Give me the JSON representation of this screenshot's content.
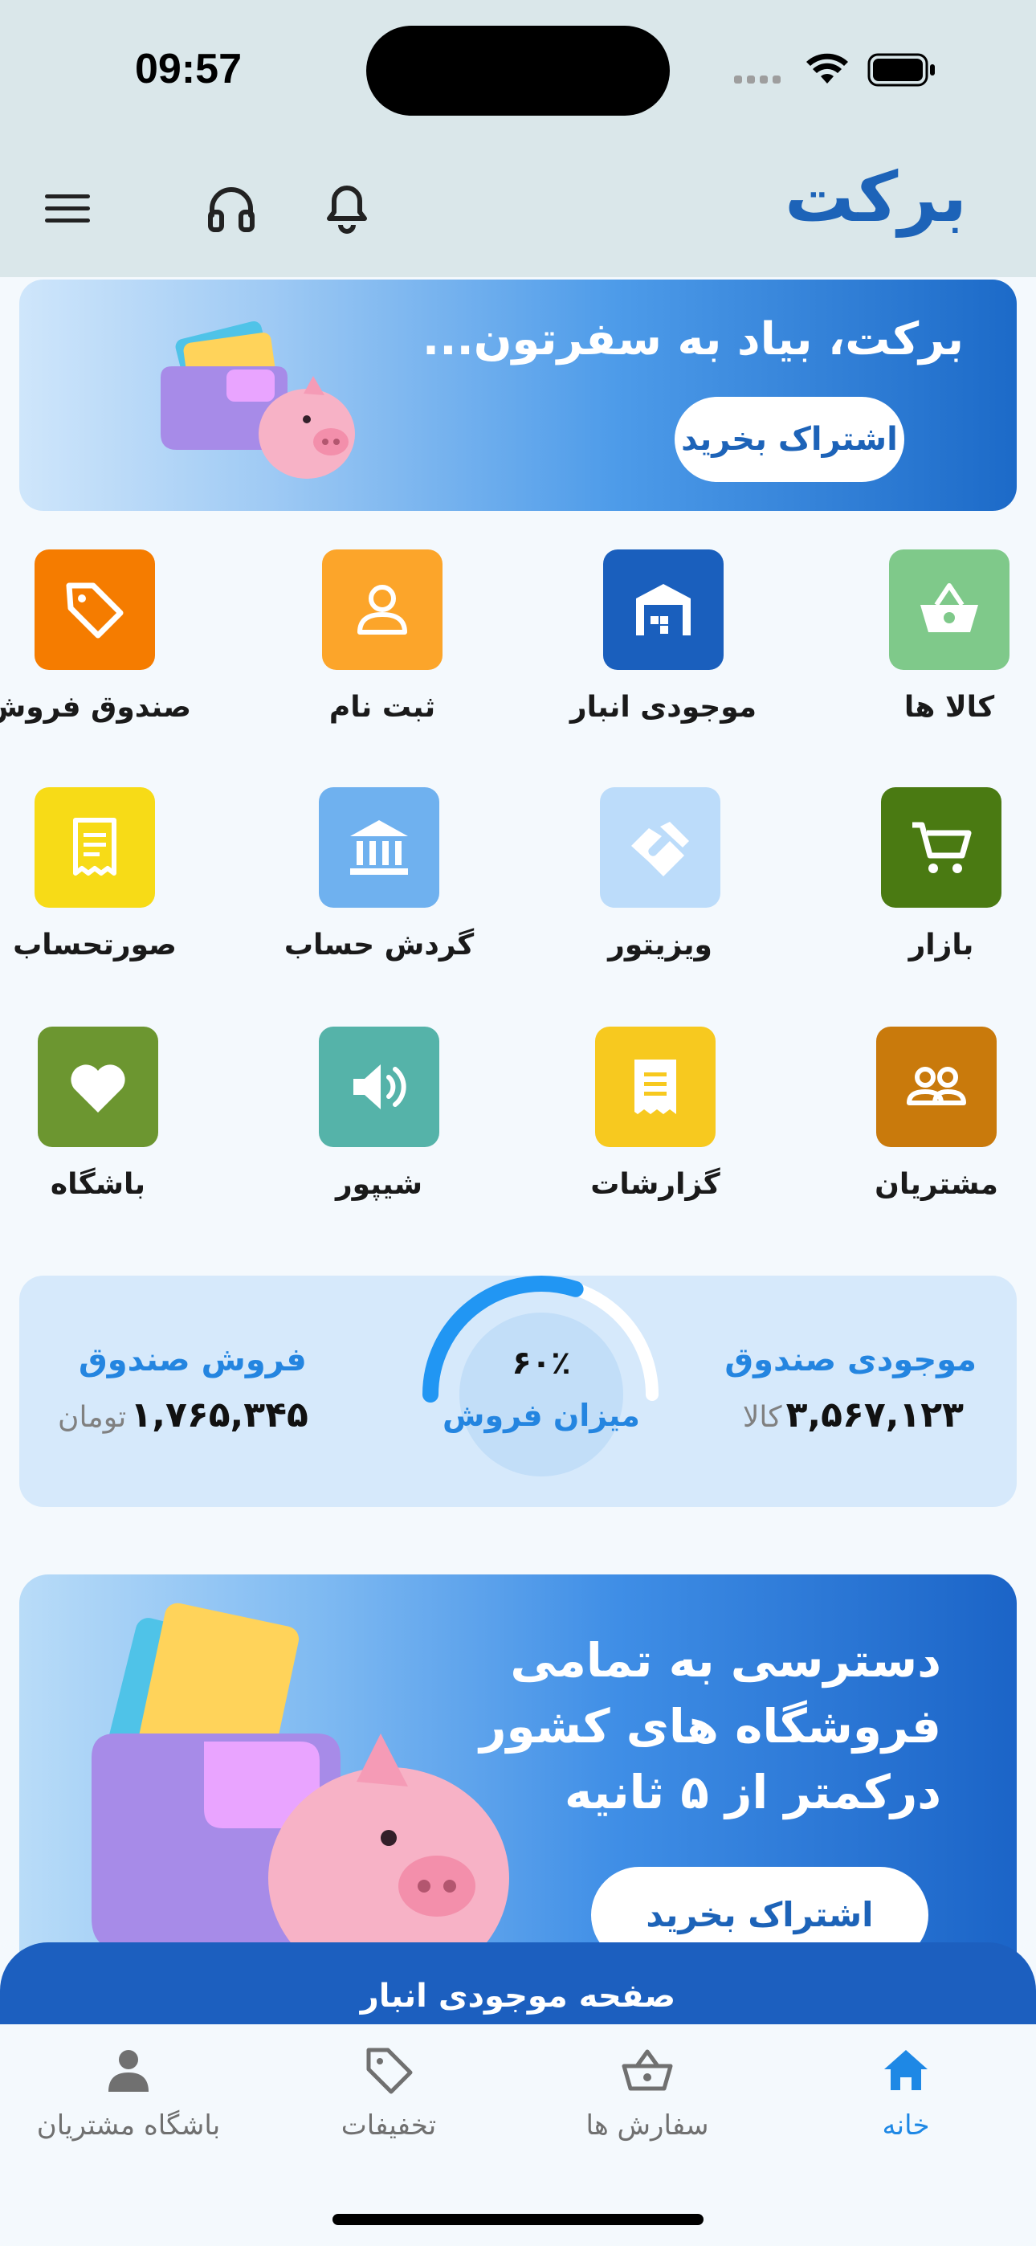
{
  "status_bar": {
    "time": "09:57"
  },
  "header": {
    "brand": "برکت"
  },
  "banner_top": {
    "title": "برکت، بیاد به سفرتون...",
    "button": "اشتراک بخرید"
  },
  "grid": [
    {
      "label": "کالا ها",
      "icon": "basket-icon",
      "color": "#7fc98a"
    },
    {
      "label": "موجودی انبار",
      "icon": "warehouse-icon",
      "color": "#1a5fbd"
    },
    {
      "label": "ثبت نام",
      "icon": "user-icon",
      "color": "#fca52a"
    },
    {
      "label": "صندوق فروش",
      "icon": "tag-icon",
      "color": "#f57c00"
    },
    {
      "label": "بازار",
      "icon": "cart-icon",
      "color": "#4a7a12"
    },
    {
      "label": "ویزیتور",
      "icon": "handshake-icon",
      "color": "#bcdcfa"
    },
    {
      "label": "گردش حساب",
      "icon": "bank-icon",
      "color": "#6fb1ef"
    },
    {
      "label": "صورتحساب",
      "icon": "receipt-icon",
      "color": "#f7db17"
    },
    {
      "label": "مشتریان",
      "icon": "customers-icon",
      "color": "#c97a0c"
    },
    {
      "label": "گزارشات",
      "icon": "report-icon",
      "color": "#f7c91f"
    },
    {
      "label": "شیپور",
      "icon": "speaker-icon",
      "color": "#55b3a9"
    },
    {
      "label": "باشگاه",
      "icon": "heart-icon",
      "color": "#6c9630"
    }
  ],
  "stats": {
    "inventory_title": "موجودی صندوق",
    "inventory_value": "۳,۵۶۷,۱۲۳",
    "inventory_unit": "کالا",
    "sales_title": "فروش صندوق",
    "sales_value": "۱,۷۶۵,۳۴۵",
    "sales_unit": "تومان",
    "gauge_percent": "۶۰٪",
    "gauge_fraction": 0.6,
    "gauge_label": "میزان فروش"
  },
  "banner_promo": {
    "line1": "دسترسی به تمامی",
    "line2": "فروشگاه های کشور",
    "line3": "درکمتر از ۵ ثانیه",
    "button": "اشتراک بخرید"
  },
  "page_bar": {
    "title": "صفحه موجودی انبار"
  },
  "bottom_nav": [
    {
      "label": "خانه",
      "icon": "home-icon",
      "active": true
    },
    {
      "label": "سفارش ها",
      "icon": "basket-icon",
      "active": false
    },
    {
      "label": "تخفیفات",
      "icon": "tag-icon",
      "active": false
    },
    {
      "label": "باشگاه مشتریان",
      "icon": "person-icon",
      "active": false
    }
  ],
  "colors": {
    "brand": "#1d63b8",
    "accent": "#2485e0",
    "active_nav": "#1e88e5"
  }
}
